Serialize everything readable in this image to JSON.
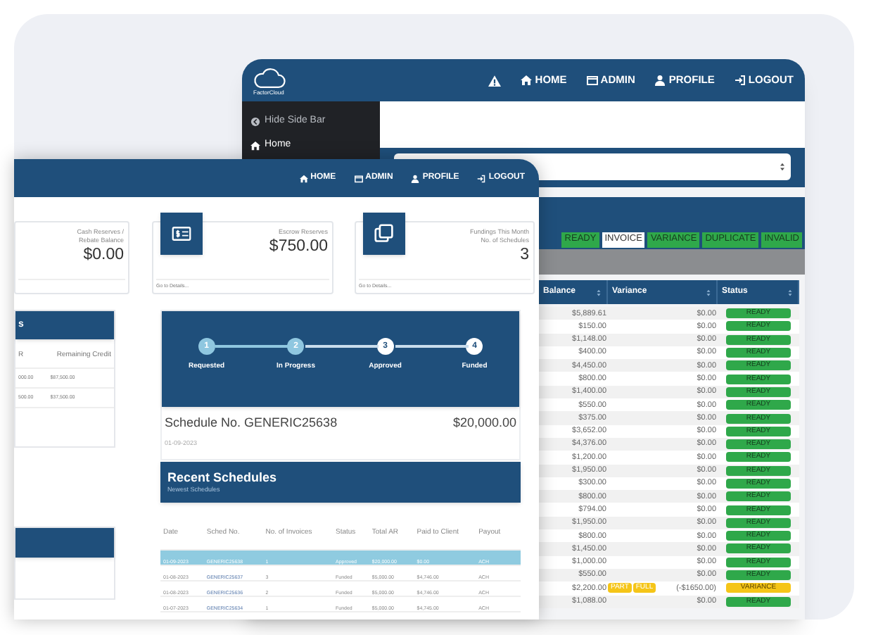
{
  "back_window": {
    "logo": "FactorCloud",
    "nav": [
      "HOME",
      "ADMIN",
      "PROFILE",
      "LOGOUT"
    ],
    "sidebar": [
      {
        "label": "Hide Side Bar",
        "selected": false
      },
      {
        "label": "Home",
        "selected": true
      }
    ],
    "filters": [
      {
        "label": "READY",
        "selected": false
      },
      {
        "label": "INVOICE",
        "selected": true
      },
      {
        "label": "VARIANCE",
        "selected": false
      },
      {
        "label": "DUPLICATE",
        "selected": false
      },
      {
        "label": "INVALID",
        "selected": false
      }
    ],
    "table": {
      "columns": [
        "Balance",
        "Variance",
        "Status"
      ],
      "rows": [
        {
          "balance": "$5,889.61",
          "variance": "$0.00",
          "status": "READY",
          "kind": "ready"
        },
        {
          "balance": "$150.00",
          "variance": "$0.00",
          "status": "READY",
          "kind": "ready"
        },
        {
          "balance": "$1,148.00",
          "variance": "$0.00",
          "status": "READY",
          "kind": "ready"
        },
        {
          "balance": "$400.00",
          "variance": "$0.00",
          "status": "READY",
          "kind": "ready"
        },
        {
          "balance": "$4,450.00",
          "variance": "$0.00",
          "status": "READY",
          "kind": "ready"
        },
        {
          "balance": "$800.00",
          "variance": "$0.00",
          "status": "READY",
          "kind": "ready"
        },
        {
          "balance": "$1,400.00",
          "variance": "$0.00",
          "status": "READY",
          "kind": "ready"
        },
        {
          "balance": "$550.00",
          "variance": "$0.00",
          "status": "READY",
          "kind": "ready"
        },
        {
          "balance": "$375.00",
          "variance": "$0.00",
          "status": "READY",
          "kind": "ready"
        },
        {
          "balance": "$3,652.00",
          "variance": "$0.00",
          "status": "READY",
          "kind": "ready"
        },
        {
          "balance": "$4,376.00",
          "variance": "$0.00",
          "status": "READY",
          "kind": "ready"
        },
        {
          "balance": "$1,200.00",
          "variance": "$0.00",
          "status": "READY",
          "kind": "ready"
        },
        {
          "balance": "$1,950.00",
          "variance": "$0.00",
          "status": "READY",
          "kind": "ready"
        },
        {
          "balance": "$300.00",
          "variance": "$0.00",
          "status": "READY",
          "kind": "ready"
        },
        {
          "balance": "$800.00",
          "variance": "$0.00",
          "status": "READY",
          "kind": "ready"
        },
        {
          "balance": "$794.00",
          "variance": "$0.00",
          "status": "READY",
          "kind": "ready"
        },
        {
          "balance": "$1,950.00",
          "variance": "$0.00",
          "status": "READY",
          "kind": "ready"
        },
        {
          "balance": "$800.00",
          "variance": "$0.00",
          "status": "READY",
          "kind": "ready"
        },
        {
          "balance": "$1,450.00",
          "variance": "$0.00",
          "status": "READY",
          "kind": "ready"
        },
        {
          "balance": "$1,000.00",
          "variance": "$0.00",
          "status": "READY",
          "kind": "ready"
        },
        {
          "balance": "$550.00",
          "variance": "$0.00",
          "status": "READY",
          "kind": "ready"
        },
        {
          "balance": "$2,200.00",
          "actions": [
            "PART",
            "FULL"
          ],
          "variance": "(-$1650.00)",
          "status": "VARIANCE",
          "kind": "variance"
        },
        {
          "balance": "$1,088.00",
          "variance": "$0.00",
          "status": "READY",
          "kind": "ready"
        }
      ]
    }
  },
  "front_window": {
    "nav": [
      "HOME",
      "ADMIN",
      "PROFILE",
      "LOGOUT"
    ],
    "cards": [
      {
        "label": "Cash Reserves / Rebate Balance",
        "value": "$0.00"
      },
      {
        "label": "Escrow Reserves",
        "value": "$750.00",
        "link": "Go to Details..."
      },
      {
        "label": "Fundings This Month",
        "sublabel": "No. of Schedules",
        "value": "3",
        "link": "Go to Details..."
      }
    ],
    "credit_panel": {
      "title": "s",
      "columns": [
        "R",
        "Remaining Credit"
      ],
      "rows": [
        [
          "000.00",
          "$87,500.00"
        ],
        [
          "500.00",
          "$37,500.00"
        ]
      ]
    },
    "steps": [
      {
        "number": "1",
        "label": "Requested",
        "done": true
      },
      {
        "number": "2",
        "label": "In Progress",
        "done": true
      },
      {
        "number": "3",
        "label": "Approved",
        "done": false
      },
      {
        "number": "4",
        "label": "Funded",
        "done": false
      }
    ],
    "schedule": {
      "title": "Schedule No. GENERIC25638",
      "amount": "$20,000.00",
      "date": "01-09-2023"
    },
    "recent": {
      "title": "Recent Schedules",
      "subtitle": "Newest Schedules",
      "columns": [
        "Date",
        "Sched No.",
        "No. of Invoices",
        "Status",
        "Total AR",
        "Paid to Client",
        "Payout"
      ],
      "rows": [
        {
          "cells": [
            "01-09-2023",
            "GENERIC25638",
            "1",
            "Approved",
            "$20,000.00",
            "$0.00",
            "ACH"
          ],
          "selected": true
        },
        {
          "cells": [
            "01-08-2023",
            "GENERIC25637",
            "3",
            "Funded",
            "$5,000.00",
            "$4,746.00",
            "ACH"
          ],
          "selected": false
        },
        {
          "cells": [
            "01-08-2023",
            "GENERIC25636",
            "2",
            "Funded",
            "$5,000.00",
            "$4,746.00",
            "ACH"
          ],
          "selected": false
        },
        {
          "cells": [
            "01-07-2023",
            "GENERIC25634",
            "1",
            "Funded",
            "$5,000.00",
            "$4,745.00",
            "ACH"
          ],
          "selected": false
        }
      ]
    }
  }
}
